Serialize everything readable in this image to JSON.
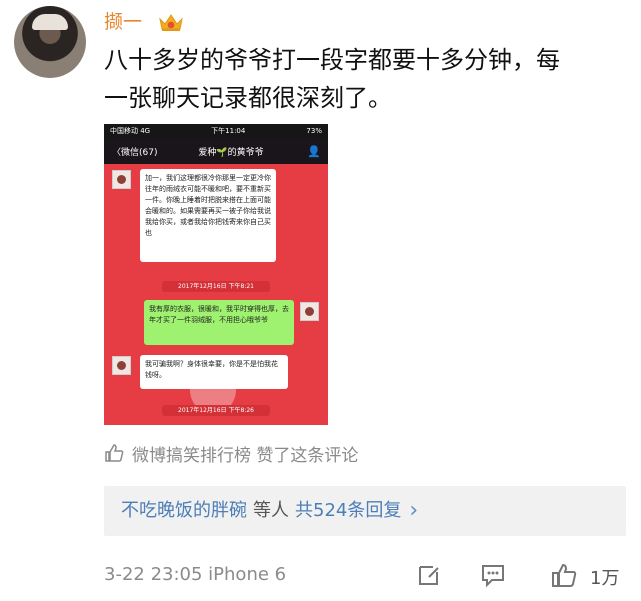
{
  "post": {
    "username": "撷一",
    "comment_line1": "八十多岁的爷爷打一段字都要十多分钟，每",
    "comment_line2": "一张聊天记录都很深刻了。"
  },
  "screenshot": {
    "status_carrier": "中国移动 4G",
    "status_time": "下午11:04",
    "status_battery": "73%",
    "back_label": "〈微信(67)",
    "chat_title": "爱种🌱的黄爷爷",
    "message1": "加一，我们这理都很冷你那里一定更冷你往年的雨绒衣可能不暖和吧，要不重新买一件。你晚上睡着时把脱来搭在上面可能会暖和的。如果需要再买一被子你给我说我给你买，或者我给你把钱寄来你自己买也",
    "timestamp1": "2017年12月16日 下午8:21",
    "message2": "我有厚的衣服，很暖和，我平时穿得也厚，去年才买了一件羽绒服，不用担心哦爷爷",
    "message3": "我可骗我啊？身体很幸要，你是不是怕我花钱呀。",
    "timestamp2": "2017年12月16日 下午8:26"
  },
  "liked_by": {
    "text": "微博搞笑排行榜 赞了这条评论"
  },
  "replies": {
    "user": "不吃晚饭的胖碗",
    "mid": "等人",
    "count": "共524条回复"
  },
  "meta": {
    "timestamp": "3-22 23:05 iPhone 6",
    "like_count": "1万"
  },
  "colors": {
    "username": "#e8862d",
    "link": "#4c7eb7",
    "chat_bg": "#e53d43"
  },
  "icons": {
    "crown": "crown-icon",
    "thumb": "thumb-up-icon",
    "edit": "edit-icon",
    "comment": "comment-icon",
    "like": "like-icon"
  }
}
